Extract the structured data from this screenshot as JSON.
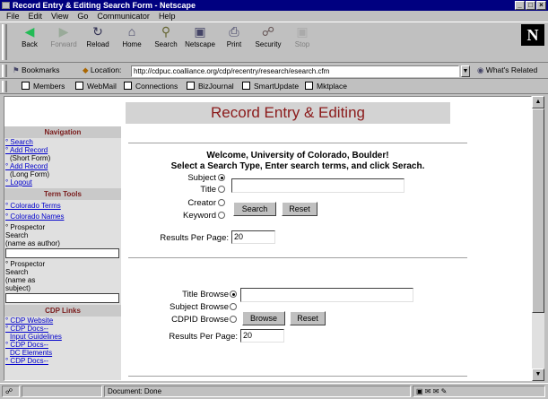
{
  "window": {
    "title": "Record Entry & Editing Search Form - Netscape",
    "buttons": [
      "_",
      "□",
      "×"
    ]
  },
  "menubar": {
    "items": [
      "File",
      "Edit",
      "View",
      "Go",
      "Communicator",
      "Help"
    ]
  },
  "toolbar": {
    "buttons": [
      {
        "label": "Back",
        "icon": "back-arrow-icon",
        "enabled": true
      },
      {
        "label": "Forward",
        "icon": "forward-arrow-icon",
        "enabled": false
      },
      {
        "label": "Reload",
        "icon": "reload-icon",
        "enabled": true
      },
      {
        "label": "Home",
        "icon": "home-icon",
        "enabled": true
      },
      {
        "label": "Search",
        "icon": "search-icon",
        "enabled": true
      },
      {
        "label": "Netscape",
        "icon": "netscape-icon",
        "enabled": true
      },
      {
        "label": "Print",
        "icon": "print-icon",
        "enabled": true
      },
      {
        "label": "Security",
        "icon": "lock-icon",
        "enabled": true
      },
      {
        "label": "Stop",
        "icon": "stop-icon",
        "enabled": false
      }
    ]
  },
  "location": {
    "bookmarks_label": "Bookmarks",
    "location_label": "Location:",
    "url": "http://cdpuc.coalliance.org/cdp/recentry/research/esearch.cfm",
    "whats_related": "What's Related"
  },
  "personal": {
    "items": [
      "Members",
      "WebMail",
      "Connections",
      "BizJournal",
      "SmartUpdate",
      "Mktplace"
    ]
  },
  "page": {
    "header": "Record Entry & Editing"
  },
  "sidebar": {
    "navigation_heading": "Navigation",
    "nav_links": [
      "° Search",
      "° Add Record"
    ],
    "short_form": "(Short Form)",
    "add_record_2": "° Add Record",
    "long_form": "(Long Form)",
    "logout": "° Logout",
    "term_tools_heading": "Term Tools",
    "colorado_terms": "° Colorado Terms",
    "colorado_names": "° Colorado Names",
    "prospector1_lines": [
      "° Prospector",
      "Search",
      "(name as author)"
    ],
    "prospector2_lines": [
      "° Prospector",
      "Search",
      "(name as",
      "subject)"
    ],
    "cdp_links_heading": "CDP Links",
    "cdp_website": "° CDP Website",
    "cdp_docs1": "° CDP Docs--",
    "input_guidelines": "Input Guidelines",
    "cdp_docs2": "° CDP Docs--",
    "dc_elements": "DC Elements",
    "cdp_docs3": "° CDP Docs--"
  },
  "search": {
    "welcome": "Welcome, University of Colorado, Boulder!",
    "instructions": "Select a Search Type, Enter search terms, and click Serach.",
    "types": [
      {
        "label": "Subject",
        "selected": true
      },
      {
        "label": "Title",
        "selected": false
      },
      {
        "label": "Creator",
        "selected": false
      },
      {
        "label": "Keyword",
        "selected": false
      }
    ],
    "term_value": "",
    "search_button": "Search",
    "reset_button": "Reset",
    "results_label": "Results Per Page:",
    "results_value": "20"
  },
  "browse": {
    "types": [
      {
        "label": "Title Browse",
        "selected": true
      },
      {
        "label": "Subject Browse",
        "selected": false
      },
      {
        "label": "CDPID Browse",
        "selected": false
      }
    ],
    "term_value": "",
    "browse_button": "Browse",
    "reset_button": "Reset",
    "results_label": "Results Per Page:",
    "results_value": "20"
  },
  "statusbar": {
    "text": "Document: Done"
  }
}
